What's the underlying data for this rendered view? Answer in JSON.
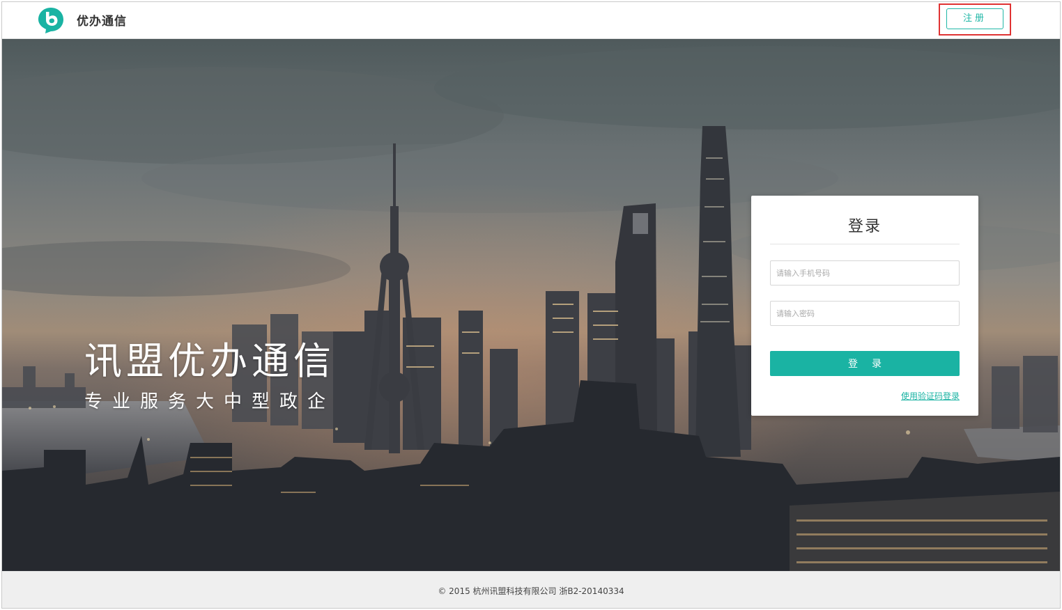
{
  "header": {
    "brand_name": "优办通信",
    "register_label": "注册"
  },
  "hero": {
    "title": "讯盟优办通信",
    "subtitle": "专业服务大中型政企"
  },
  "login": {
    "title": "登录",
    "phone_placeholder": "请输入手机号码",
    "password_placeholder": "请输入密码",
    "submit_label": "登录",
    "sms_login_link": "使用验证码登录"
  },
  "footer": {
    "copyright": "© 2015 杭州讯盟科技有限公司 浙B2-20140334"
  },
  "colors": {
    "accent": "#1ab3a3",
    "highlight_border": "#e03333"
  },
  "icons": {
    "logo": "speech-bubble-b-logo-icon"
  }
}
